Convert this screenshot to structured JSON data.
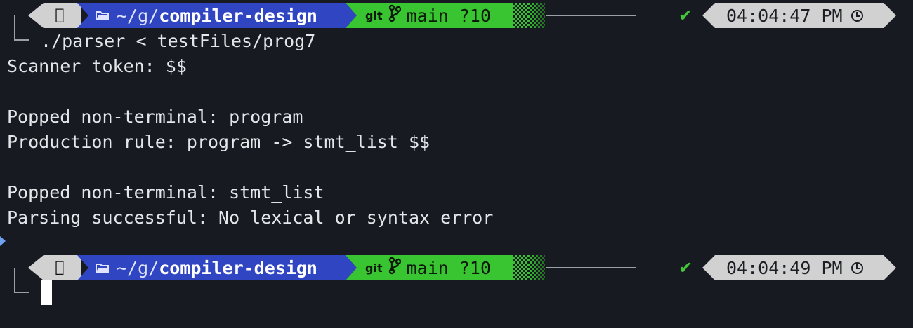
{
  "prompts": [
    {
      "dir_prefix": "~/g/",
      "dir_name": "compiler-design",
      "git_label": "git",
      "branch": "main",
      "status": "?10",
      "time": "04:04:47 PM",
      "command": "./parser < testFiles/prog7"
    },
    {
      "dir_prefix": "~/g/",
      "dir_name": "compiler-design",
      "git_label": "git",
      "branch": "main",
      "status": "?10",
      "time": "04:04:49 PM",
      "command": ""
    }
  ],
  "output": [
    "Scanner token: $$",
    "",
    "Popped non-terminal: program",
    "Production rule: program -> stmt_list $$",
    "",
    "Popped non-terminal: stmt_list",
    "Parsing successful: No lexical or syntax error"
  ],
  "icons": {
    "os": "apple-icon",
    "dir": "folder-icon",
    "branch": "git-branch-icon",
    "success": "check-icon",
    "time": "clock-icon"
  },
  "colors": {
    "background": "#171a21",
    "os_segment": "#d1d1d1",
    "dir_segment": "#3045c1",
    "git_segment": "#39c531",
    "time_segment": "#d1d1d1",
    "success": "#44c43a",
    "marker": "#6fa3f2"
  }
}
